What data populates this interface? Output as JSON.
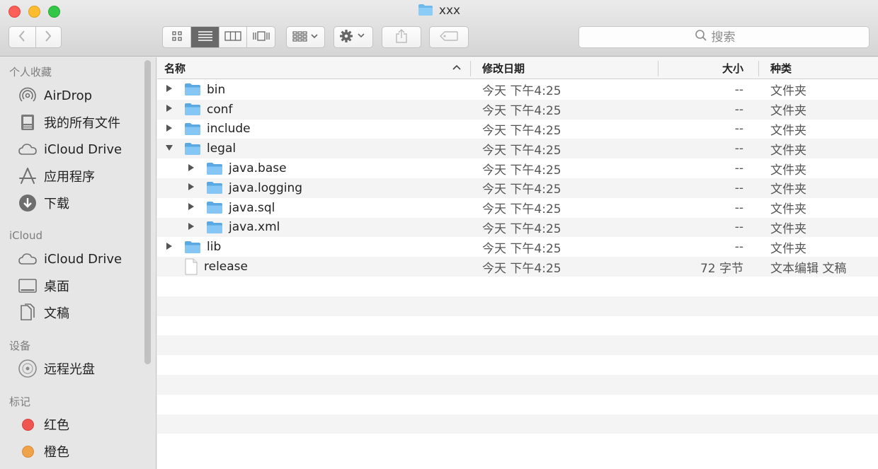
{
  "window": {
    "title": "xxx"
  },
  "toolbar": {
    "back_icon": "chevron-left-icon",
    "forward_icon": "chevron-right-icon",
    "view_modes": [
      "icon-view",
      "list-view",
      "column-view",
      "cover-flow-view"
    ],
    "active_view": "list-view",
    "arrange_icon": "arrange-grid-icon",
    "action_icon": "gear-icon",
    "share_icon": "share-icon",
    "tag_icon": "tag-icon",
    "search_placeholder": "搜索"
  },
  "sidebar": {
    "sections": [
      {
        "heading": "个人收藏",
        "items": [
          {
            "label": "AirDrop",
            "icon": "airdrop-icon"
          },
          {
            "label": "我的所有文件",
            "icon": "all-files-icon"
          },
          {
            "label": "iCloud Drive",
            "icon": "cloud-icon"
          },
          {
            "label": "应用程序",
            "icon": "applications-icon"
          },
          {
            "label": "下载",
            "icon": "download-icon"
          }
        ]
      },
      {
        "heading": "iCloud",
        "items": [
          {
            "label": "iCloud Drive",
            "icon": "cloud-icon"
          },
          {
            "label": "桌面",
            "icon": "desktop-icon"
          },
          {
            "label": "文稿",
            "icon": "documents-icon"
          }
        ]
      },
      {
        "heading": "设备",
        "items": [
          {
            "label": "远程光盘",
            "icon": "disc-icon"
          }
        ]
      },
      {
        "heading": "标记",
        "items": [
          {
            "label": "红色",
            "icon": "red-tag-icon",
            "color": "#f0554f"
          },
          {
            "label": "橙色",
            "icon": "orange-tag-icon",
            "color": "#f0a24a"
          }
        ]
      }
    ]
  },
  "columns": {
    "name": "名称",
    "date": "修改日期",
    "size": "大小",
    "kind": "种类"
  },
  "files": [
    {
      "name": "bin",
      "type": "folder",
      "level": 0,
      "expanded": false,
      "date": "今天 下午4:25",
      "size": "--",
      "kind": "文件夹"
    },
    {
      "name": "conf",
      "type": "folder",
      "level": 0,
      "expanded": false,
      "date": "今天 下午4:25",
      "size": "--",
      "kind": "文件夹"
    },
    {
      "name": "include",
      "type": "folder",
      "level": 0,
      "expanded": false,
      "date": "今天 下午4:25",
      "size": "--",
      "kind": "文件夹"
    },
    {
      "name": "legal",
      "type": "folder",
      "level": 0,
      "expanded": true,
      "date": "今天 下午4:25",
      "size": "--",
      "kind": "文件夹"
    },
    {
      "name": "java.base",
      "type": "folder",
      "level": 1,
      "expanded": false,
      "date": "今天 下午4:25",
      "size": "--",
      "kind": "文件夹"
    },
    {
      "name": "java.logging",
      "type": "folder",
      "level": 1,
      "expanded": false,
      "date": "今天 下午4:25",
      "size": "--",
      "kind": "文件夹"
    },
    {
      "name": "java.sql",
      "type": "folder",
      "level": 1,
      "expanded": false,
      "date": "今天 下午4:25",
      "size": "--",
      "kind": "文件夹"
    },
    {
      "name": "java.xml",
      "type": "folder",
      "level": 1,
      "expanded": false,
      "date": "今天 下午4:25",
      "size": "--",
      "kind": "文件夹"
    },
    {
      "name": "lib",
      "type": "folder",
      "level": 0,
      "expanded": false,
      "date": "今天 下午4:25",
      "size": "--",
      "kind": "文件夹"
    },
    {
      "name": "release",
      "type": "file",
      "level": 0,
      "expanded": false,
      "date": "今天 下午4:25",
      "size": "72 字节",
      "kind": "文本编辑 文稿"
    }
  ],
  "empty_rows": 9
}
